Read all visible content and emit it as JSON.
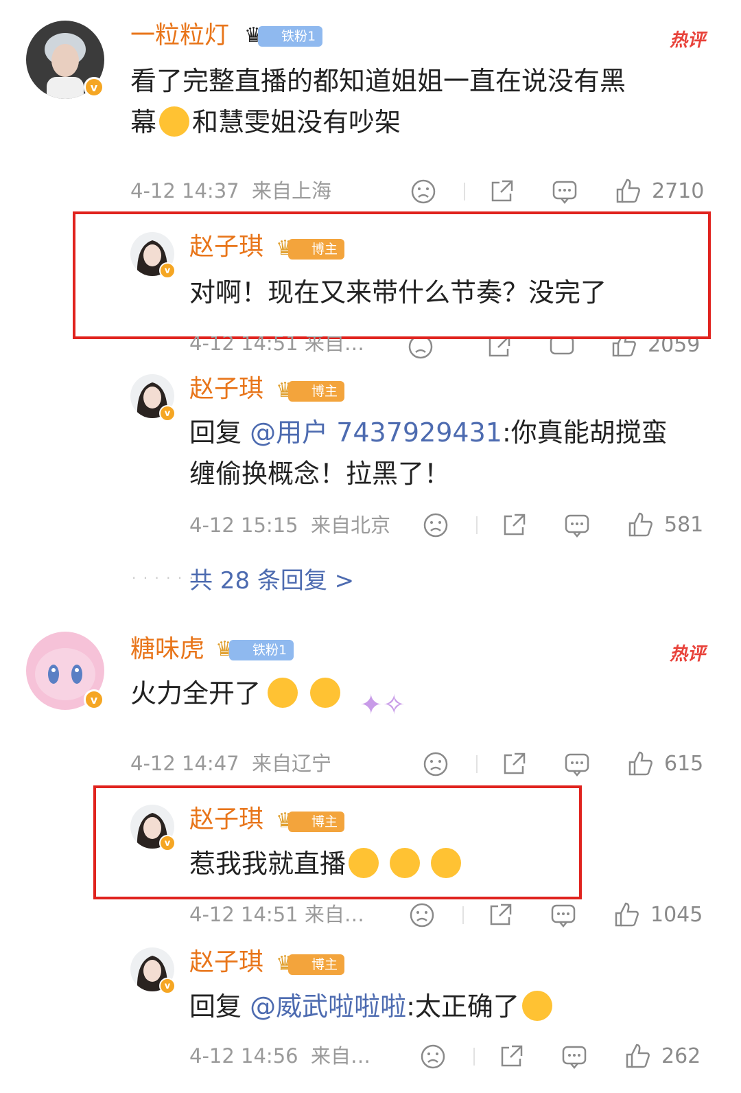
{
  "comments": [
    {
      "user": "一粒粒灯",
      "tag": "铁粉1",
      "hot": "热评",
      "text": "看了完整直播的都知道姐姐一直在说没有黑",
      "text2": "幕",
      "text2b": "和慧雯姐没有吵架",
      "time": "4-12 14:37",
      "location": "来自上海",
      "likes": "2710"
    },
    {
      "user": "赵子琪",
      "tag": "博主",
      "text": "对啊！现在又来带什么节奏？没完了",
      "time": "4-12 14:51",
      "location": "来自…",
      "likes": "2059"
    },
    {
      "user": "赵子琪",
      "tag": "博主",
      "reply_prefix": "回复",
      "mention": "@用户 7437929431",
      "text": ":你真能胡搅蛮",
      "text2": "缠偷换概念！拉黑了！",
      "time": "4-12 15:15",
      "location": "来自北京",
      "likes": "581"
    },
    {
      "more_replies": "共 28 条回复 >"
    },
    {
      "user": "糖味虎",
      "tag": "铁粉1",
      "hot": "热评",
      "text": "火力全开了",
      "time": "4-12 14:47",
      "location": "来自辽宁",
      "likes": "615"
    },
    {
      "user": "赵子琪",
      "tag": "博主",
      "text": "惹我我就直播",
      "time": "4-12 14:51",
      "location": "来自…",
      "likes": "1045"
    },
    {
      "user": "赵子琪",
      "tag": "博主",
      "reply_prefix": "回复",
      "mention": "@威武啦啦啦",
      "text": ":太正确了",
      "time": "4-12 14:56",
      "location": "来自…",
      "likes": "262"
    }
  ],
  "colors": {
    "username": "#e8751a",
    "mention": "#4d6bb0",
    "highlight_box": "#e0231e",
    "hot": "#e8423a"
  },
  "icons": [
    "dislike-face-icon",
    "share-icon",
    "comment-icon",
    "like-thumb-icon",
    "verified-v-icon",
    "crown-icon"
  ]
}
